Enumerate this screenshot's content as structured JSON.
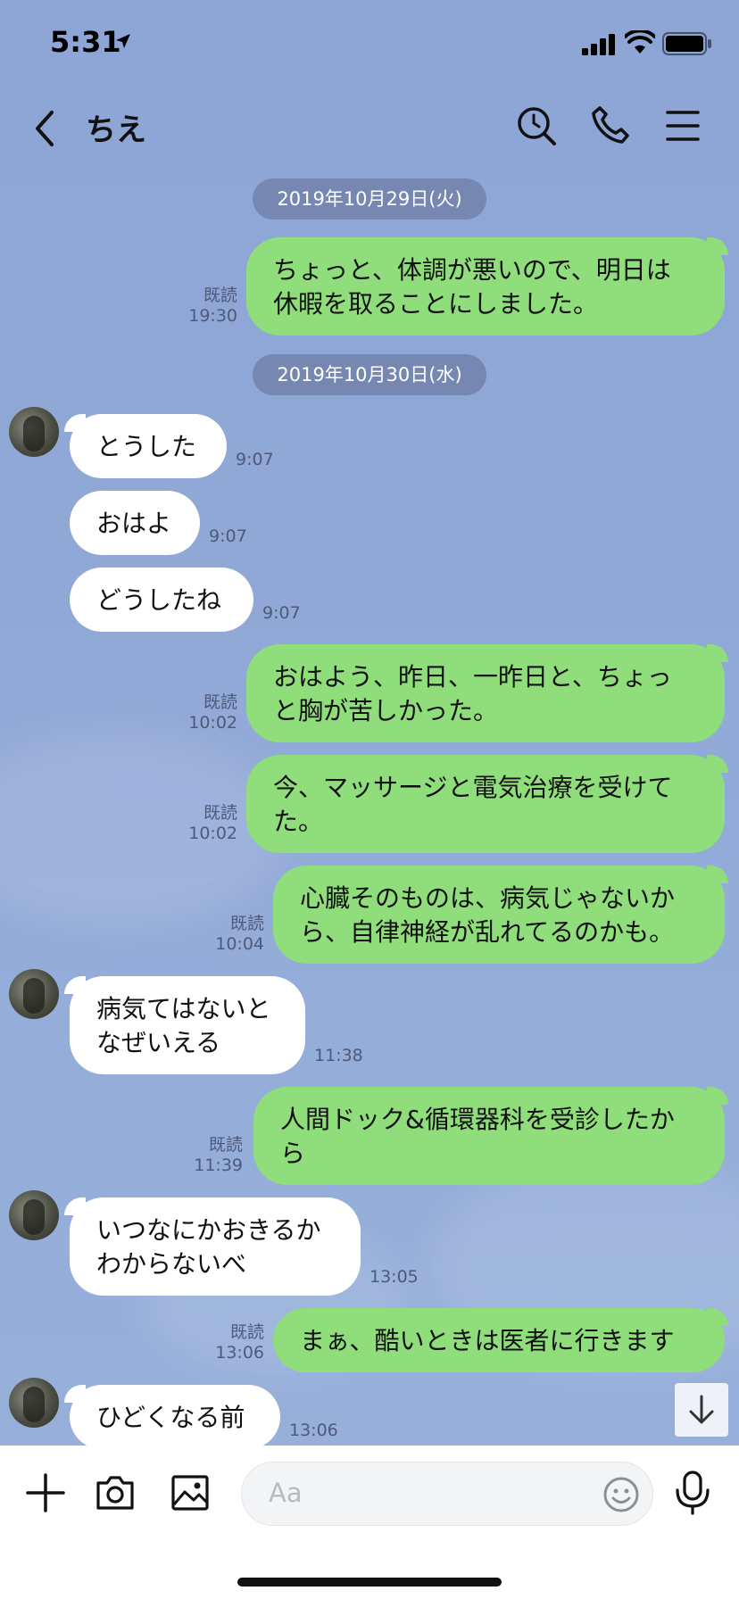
{
  "status_bar": {
    "time": "5:31"
  },
  "header": {
    "title": "ちえ"
  },
  "dates": [
    "2019年10月29日(火)",
    "2019年10月30日(水)"
  ],
  "messages": [
    {
      "dir": "out",
      "lines": [
        "ちょっと、体調が悪いので、明日は",
        "休暇を取ることにしました。"
      ],
      "read": "既読",
      "time": "19:30"
    },
    {
      "dir": "in",
      "lines": [
        "とうした"
      ],
      "time": "9:07"
    },
    {
      "dir": "in",
      "lines": [
        "おはよ"
      ],
      "time": "9:07"
    },
    {
      "dir": "in",
      "lines": [
        "どうしたね"
      ],
      "time": "9:07"
    },
    {
      "dir": "out",
      "lines": [
        "おはよう、昨日、一昨日と、ちょっ",
        "と胸が苦しかった。"
      ],
      "read": "既読",
      "time": "10:02"
    },
    {
      "dir": "out",
      "lines": [
        "今、マッサージと電気治療を受けて",
        "た。"
      ],
      "read": "既読",
      "time": "10:02"
    },
    {
      "dir": "out",
      "lines": [
        "心臓そのものは、病気じゃないか",
        "ら、自律神経が乱れてるのかも。"
      ],
      "read": "既読",
      "time": "10:04"
    },
    {
      "dir": "in",
      "lines": [
        "病気てはないと",
        "なぜいえる"
      ],
      "time": "11:38"
    },
    {
      "dir": "out",
      "lines": [
        "人間ドック&循環器科を受診したか",
        "ら"
      ],
      "read": "既読",
      "time": "11:39"
    },
    {
      "dir": "in",
      "lines": [
        "いつなにかおきるか",
        "わからないべ"
      ],
      "time": "13:05"
    },
    {
      "dir": "out",
      "lines": [
        "まぁ、酷いときは医者に行きます"
      ],
      "read": "既読",
      "time": "13:06"
    },
    {
      "dir": "in",
      "lines": [
        "ひどくなる前"
      ],
      "time": "13:06"
    }
  ],
  "input": {
    "placeholder": "Aa"
  },
  "colors": {
    "background": "#8ea6d6",
    "outgoing_bubble": "#8fde7b",
    "incoming_bubble": "#ffffff"
  }
}
